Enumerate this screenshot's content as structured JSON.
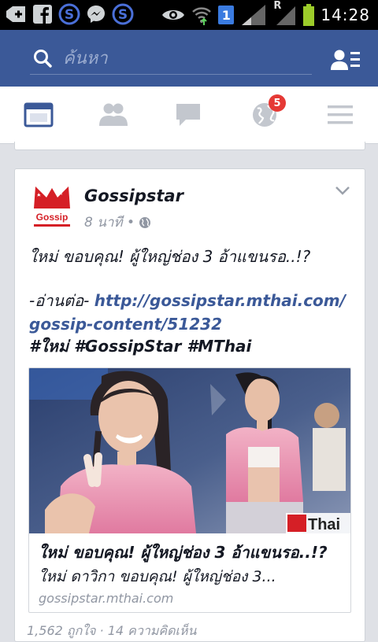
{
  "status_bar": {
    "time": "14:28",
    "notification_count": "1",
    "roaming": "R",
    "icons": [
      "add-icon",
      "facebook-icon",
      "skype-icon",
      "messenger-icon",
      "skype-icon",
      "eye-icon",
      "wifi-icon",
      "signal-icon",
      "battery-icon"
    ]
  },
  "header": {
    "search_placeholder": "ค้นหา",
    "icons": [
      "search-icon",
      "friend-requests-icon"
    ],
    "brand_color": "#3b5998"
  },
  "tabs": {
    "items": [
      "news-feed",
      "friends",
      "messages",
      "notifications",
      "more"
    ],
    "active": "news-feed",
    "notification_badge": "5"
  },
  "post": {
    "author": "Gossipstar",
    "time": "8 นาที •",
    "privacy_icon": "globe-icon",
    "text_line1": "ใหม่ ขอบคุณ! ผู้ใหญ่ช่อง 3 อ้าแขนรอ..!?",
    "read_more_label": "-อ่านต่อ-",
    "link_line1": "http://gossipstar.mthai.com/",
    "link_line2": "gossip-content/51232",
    "hashtags": "#ใหม่ #GossipStar #MThai",
    "attachment": {
      "title": "ใหม่ ขอบคุณ! ผู้ใหญ่ช่อง 3 อ้าแขนรอ..!?",
      "description": "ใหม่ ดาวิกา ขอบคุณ! ผู้ใหญ่ช่อง 3...",
      "domain": "gossipstar.mthai.com",
      "watermark": "Thai"
    },
    "cutoff_text": "1,562 ถูกใจ · 14 ความคิดเห็น"
  }
}
